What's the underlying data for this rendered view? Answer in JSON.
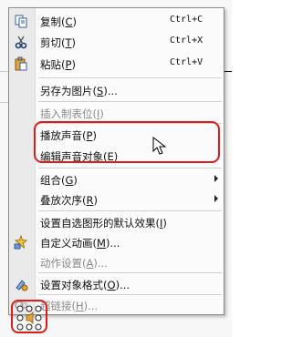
{
  "menu": {
    "items": [
      {
        "label": "复制",
        "key": "C",
        "shortcut": "Ctrl+C",
        "icon": "copy-icon"
      },
      {
        "label": "剪切",
        "key": "T",
        "shortcut": "Ctrl+X",
        "icon": "scissors-icon"
      },
      {
        "label": "粘贴",
        "key": "P",
        "shortcut": "Ctrl+V",
        "icon": "clipboard-icon"
      },
      {
        "label": "另存为图片",
        "key": "S",
        "suffix": "..."
      },
      {
        "label": "插入制表位",
        "key": "I",
        "disabled": true
      },
      {
        "label": "播放声音",
        "key": "P"
      },
      {
        "label": "编辑声音对象",
        "key": "E"
      },
      {
        "label": "组合",
        "key": "G",
        "submenu": true
      },
      {
        "label": "叠放次序",
        "key": "R",
        "submenu": true
      },
      {
        "label": "设置自选图形的默认效果",
        "key": "I"
      },
      {
        "label": "自定义动画",
        "key": "M",
        "suffix": "...",
        "icon": "animation-icon"
      },
      {
        "label": "动作设置",
        "key": "A",
        "suffix": "...",
        "disabled": true
      },
      {
        "label": "设置对象格式",
        "key": "O",
        "suffix": "...",
        "icon": "format-icon"
      },
      {
        "label": "超链接",
        "key": "H",
        "suffix": "...",
        "disabled": true,
        "icon": "hyperlink-icon"
      }
    ]
  },
  "colors": {
    "highlight": "#e01b1b",
    "disabled": "#8a8a8a"
  }
}
